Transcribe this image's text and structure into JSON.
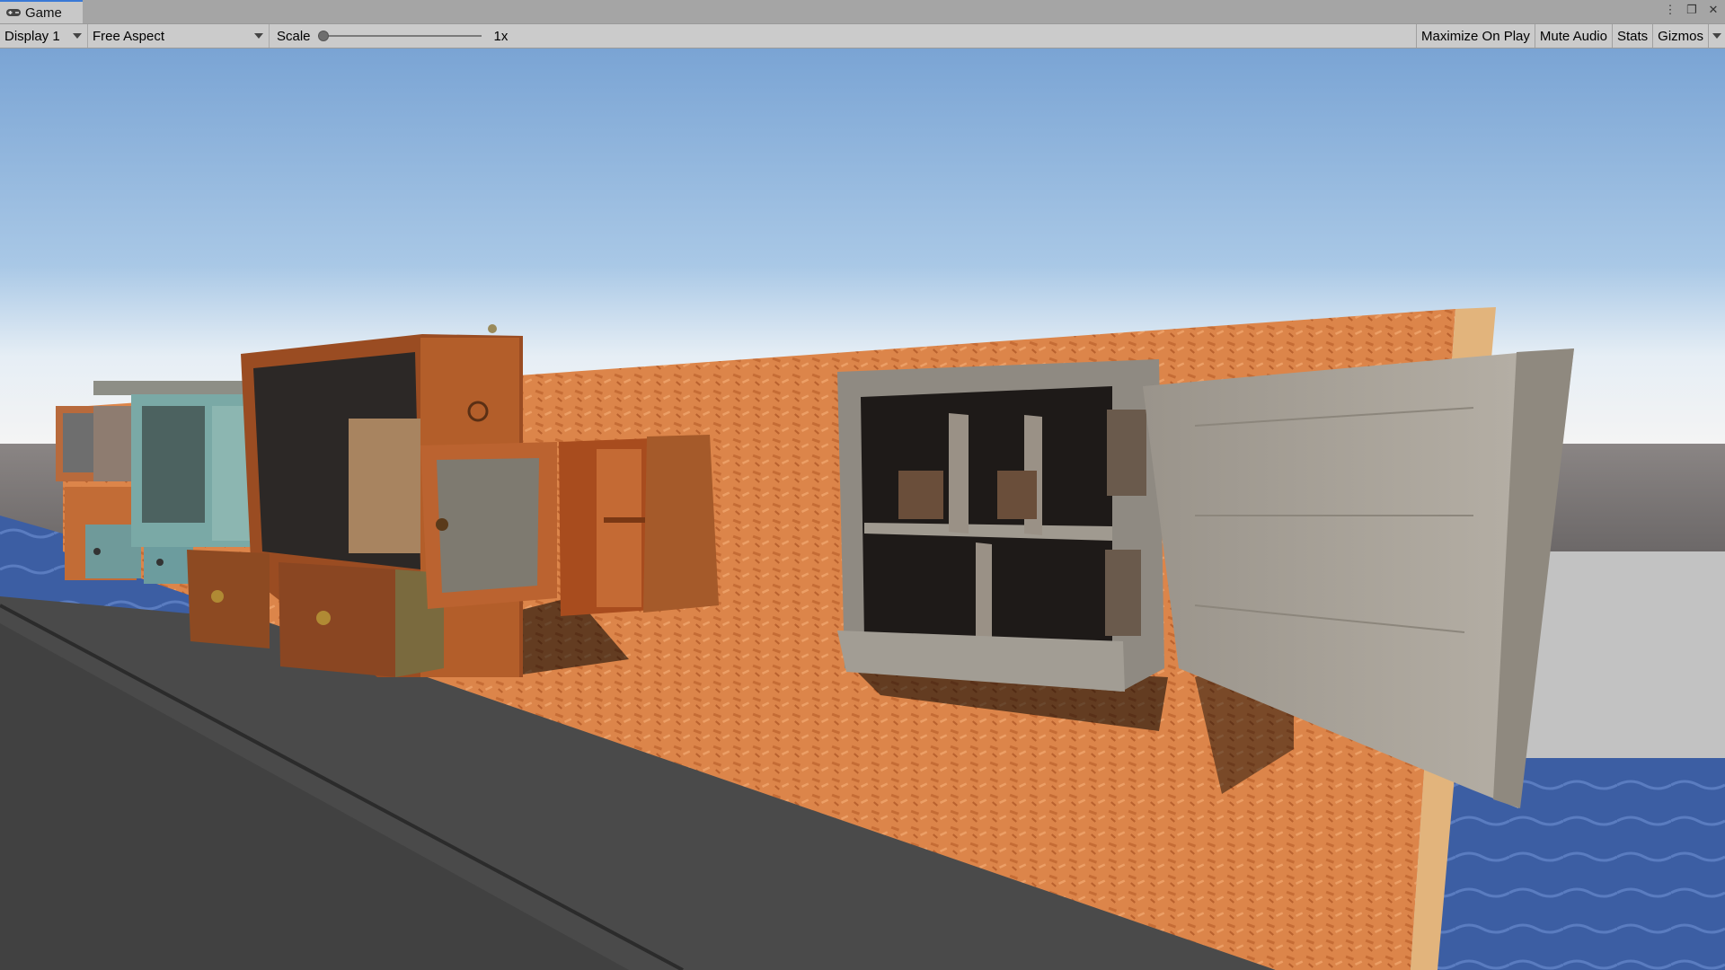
{
  "window": {
    "tab_label": "Game",
    "tab_icon": "gamepad-icon"
  },
  "toolbar": {
    "display_label": "Display 1",
    "aspect_label": "Free Aspect",
    "scale_label": "Scale",
    "scale_value": "1x",
    "maximize_label": "Maximize On Play",
    "mute_label": "Mute Audio",
    "stats_label": "Stats",
    "gizmos_label": "Gizmos"
  },
  "colors": {
    "editor_chrome": "#cbcbcb",
    "tab_accent": "#3a79d6",
    "sky_top": "#7aa4d4",
    "horizon": "#f2f2f2",
    "wall_orange": "#d9834a",
    "floor_dark": "#4b4b4b",
    "water_blue": "#3d5d9e"
  }
}
